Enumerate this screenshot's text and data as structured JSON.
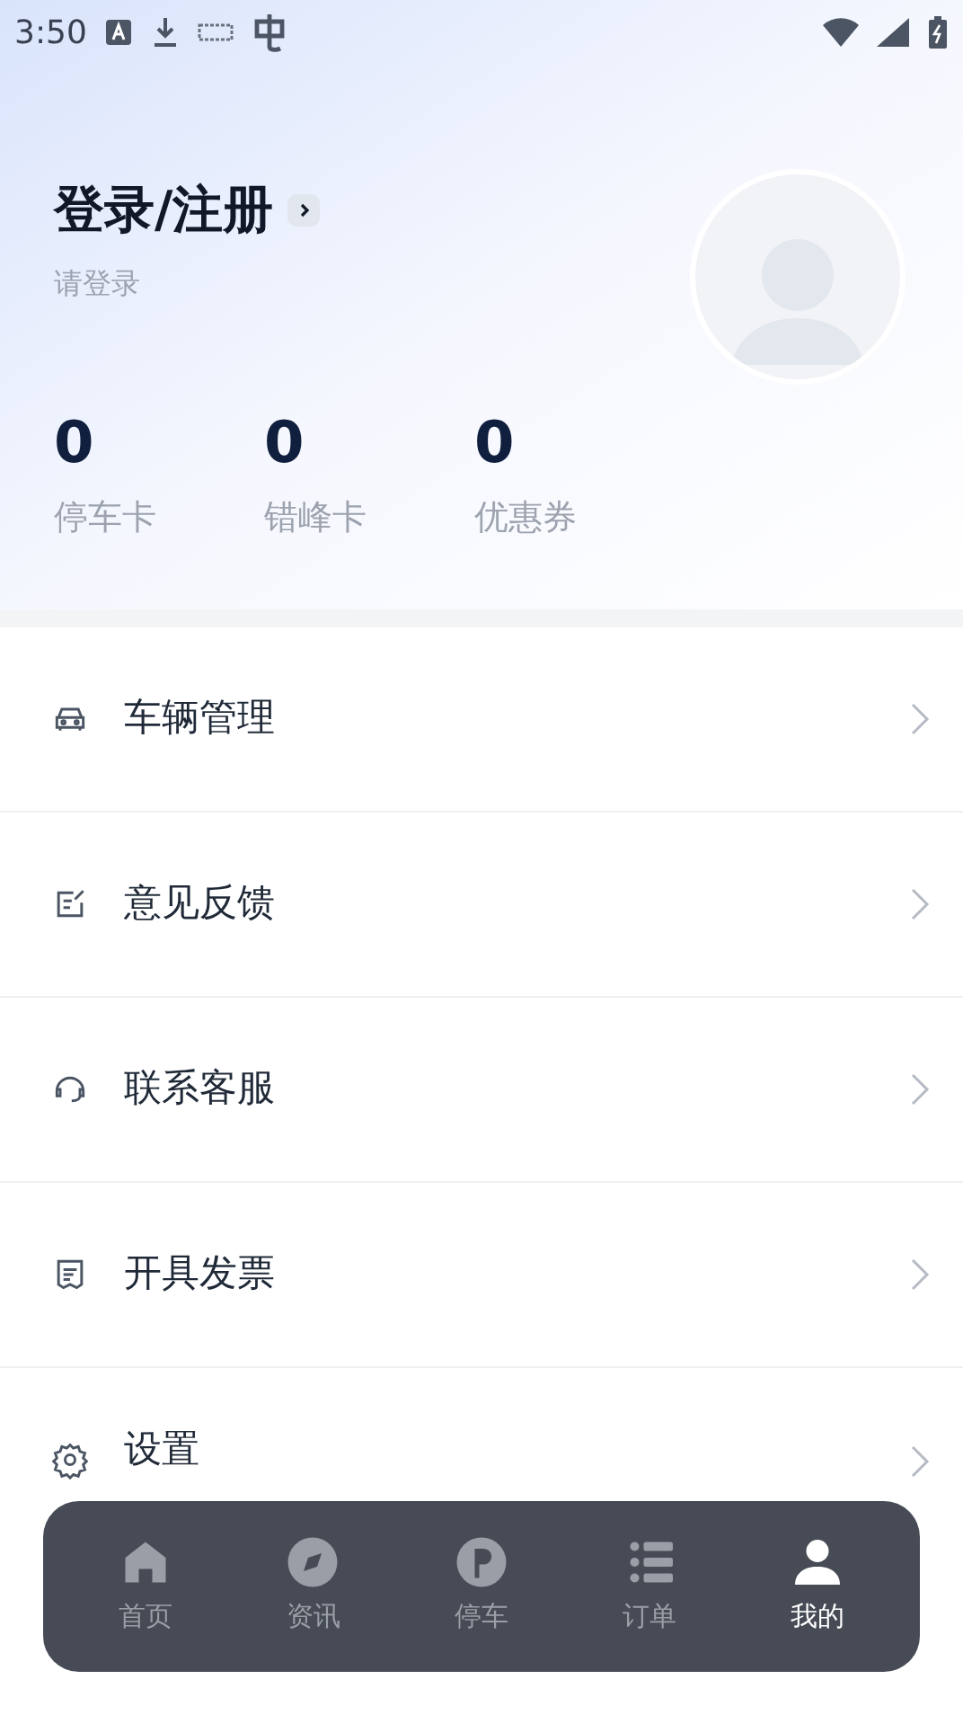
{
  "status_bar": {
    "time": "3:50"
  },
  "profile": {
    "title": "登录/注册",
    "subtitle": "请登录"
  },
  "stats": [
    {
      "value": "0",
      "label": "停车卡"
    },
    {
      "value": "0",
      "label": "错峰卡"
    },
    {
      "value": "0",
      "label": "优惠券"
    }
  ],
  "menu": [
    {
      "kind": "car",
      "label": "车辆管理"
    },
    {
      "kind": "feedback",
      "label": "意见反馈"
    },
    {
      "kind": "support",
      "label": "联系客服"
    },
    {
      "kind": "invoice",
      "label": "开具发票"
    },
    {
      "kind": "settings",
      "label": "设置"
    }
  ],
  "tab_bar": [
    {
      "kind": "home",
      "label": "首页",
      "selected": false
    },
    {
      "kind": "news",
      "label": "资讯",
      "selected": false
    },
    {
      "kind": "parking",
      "label": "停车",
      "selected": false
    },
    {
      "kind": "orders",
      "label": "订单",
      "selected": false
    },
    {
      "kind": "me",
      "label": "我的",
      "selected": true
    }
  ]
}
